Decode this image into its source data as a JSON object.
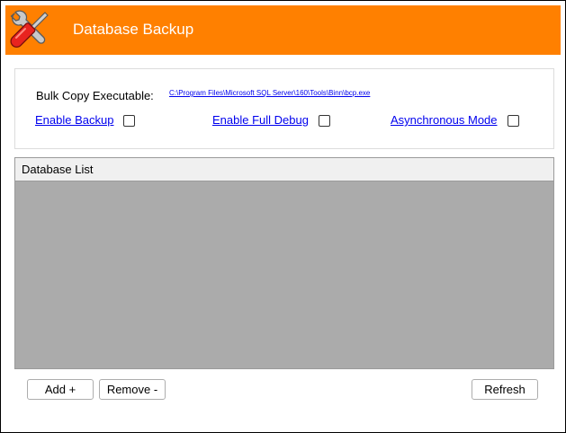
{
  "window": {
    "title": "Database Backup",
    "header_color": "#ff8000",
    "icon": "tools-icon"
  },
  "settings": {
    "bcp_label": "Bulk Copy Executable:",
    "bcp_path": "C:\\Program Files\\Microsoft SQL Server\\160\\Tools\\Binn\\bcp.exe",
    "options": [
      {
        "label": "Enable Backup",
        "checked": false
      },
      {
        "label": "Enable Full Debug",
        "checked": false
      },
      {
        "label": "Asynchronous Mode",
        "checked": false
      }
    ]
  },
  "database_list": {
    "header": "Database List",
    "rows": []
  },
  "buttons": {
    "add": "Add +",
    "remove": "Remove -",
    "refresh": "Refresh"
  }
}
